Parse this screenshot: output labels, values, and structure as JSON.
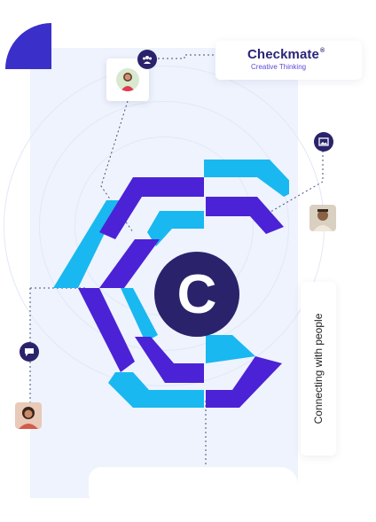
{
  "brand": {
    "name": "Checkmate",
    "registered_mark": "®",
    "tagline": "Creative Thinking"
  },
  "tag": {
    "label": "Connecting with people"
  },
  "icons": {
    "top": "group-icon",
    "right": "gallery-icon",
    "left": "chat-bubble-icon"
  },
  "colors": {
    "panel_bg": "#eef3fd",
    "accent_purple": "#3b2fc9",
    "accent_cyan": "#19b8f0",
    "accent_violet": "#4b22d6",
    "navy": "#2a236b"
  }
}
